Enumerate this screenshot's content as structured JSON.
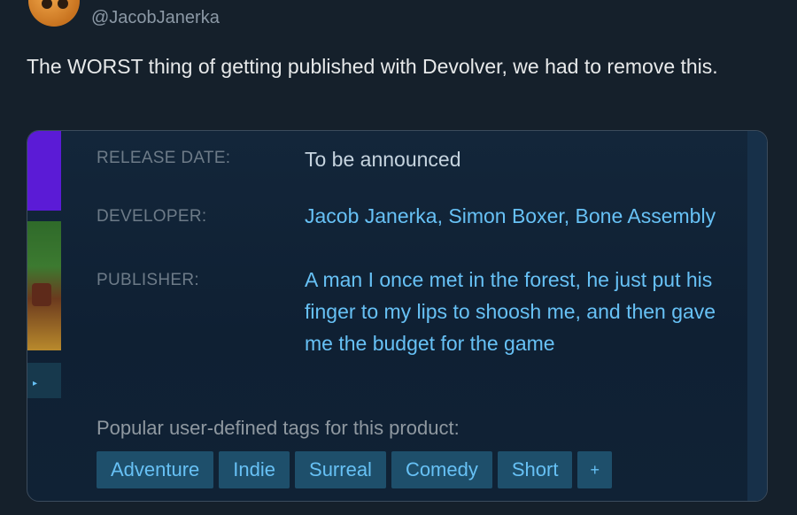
{
  "tweet": {
    "handle": "@JacobJanerka",
    "text": "The WORST thing of getting published with Devolver, we had to remove this."
  },
  "card": {
    "release_date_label": "RELEASE DATE:",
    "release_date_value": "To be announced",
    "developer_label": "DEVELOPER:",
    "developer_value": "Jacob Janerka, Simon Boxer, Bone Assembly",
    "publisher_label": "PUBLISHER:",
    "publisher_value": "A man I once met in the forest, he just put his finger to my lips to shoosh me, and then gave me the budget for the game",
    "tags_title": "Popular user-defined tags for this product:",
    "tags": [
      "Adventure",
      "Indie",
      "Surreal",
      "Comedy",
      "Short",
      "+"
    ]
  },
  "colors": {
    "background": "#15202b",
    "link": "#67c1f5",
    "tag_bg": "#1e4f6b",
    "muted_label": "#6d7b88"
  }
}
